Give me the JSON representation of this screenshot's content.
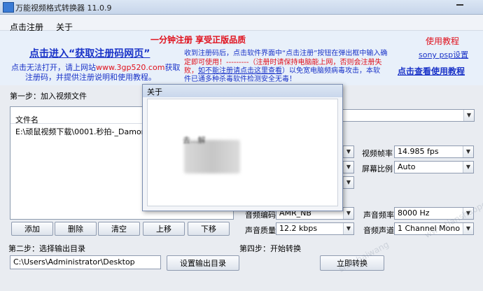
{
  "window": {
    "title": "万能视频格式转换器 11.0.9"
  },
  "menu": {
    "register": "点击注册",
    "about": "关于"
  },
  "banner": {
    "headline": "一分钟注册  享受正版品质",
    "tutorial": "使用教程",
    "get_code_link": "点击进入“获取注册码网页”",
    "cannot_open_1": "点击无法打开，请上网站",
    "site": "www.3gp520.com",
    "cannot_open_2": "获取",
    "cannot_open_3": "注册码，并提供注册说明和使用教程。",
    "notice_1": "收到注册码后，点击软件界面中“点击注册”按钮在弹出框中输入确",
    "notice_2a": "定即可使用！---------（注册时请保持电脑能上网，否则会注册失",
    "notice_3a": "败，",
    "notice_3_link": "如不能注册请点击这里查看",
    "notice_3b": "）以免宽电脑频病毒攻击，本软",
    "notice_4": "件已通多种杀毒软件检测安全无毒！",
    "sony_link": "sony psp设置",
    "guide_link": "点击查看使用教程"
  },
  "step1": {
    "label": "第一步：加入视频文件"
  },
  "file_list": {
    "header": "文件名",
    "rows": [
      "E:\\顽鼠视频下载\\0001.秒拍-_Damon H"
    ]
  },
  "buttons": {
    "add": "添加",
    "delete": "删除",
    "clear": "清空",
    "up": "上移",
    "down": "下移",
    "set_output": "设置输出目录",
    "start": "立即转换"
  },
  "params": {
    "video_fps_label": "视频帧率",
    "video_fps": "14.985 fps",
    "aspect_label": "屏幕比例",
    "aspect": "Auto",
    "audio_codec_label": "音频编码",
    "audio_codec": "AMR_NB",
    "sample_rate_label": "声音频率",
    "sample_rate": "8000 Hz",
    "quality_label": "声音质量",
    "quality": "12.2 kbps",
    "channel_label": "音频声道",
    "channel": "1 Channel Mono"
  },
  "step2": {
    "label": "第二步：选择输出目录",
    "path": "C:\\Users\\Administrator\\Desktop"
  },
  "step4": {
    "label": "第四步：开始转换"
  },
  "dialog": {
    "title": "关于",
    "text": "去...解"
  },
  "watermarks": [
    "www.tianshaopc.com",
    "shaobaiwang"
  ],
  "colors": {
    "link_blue": "#1a33c8",
    "red": "#e0101c",
    "window_bg": "#e9ecf1"
  }
}
